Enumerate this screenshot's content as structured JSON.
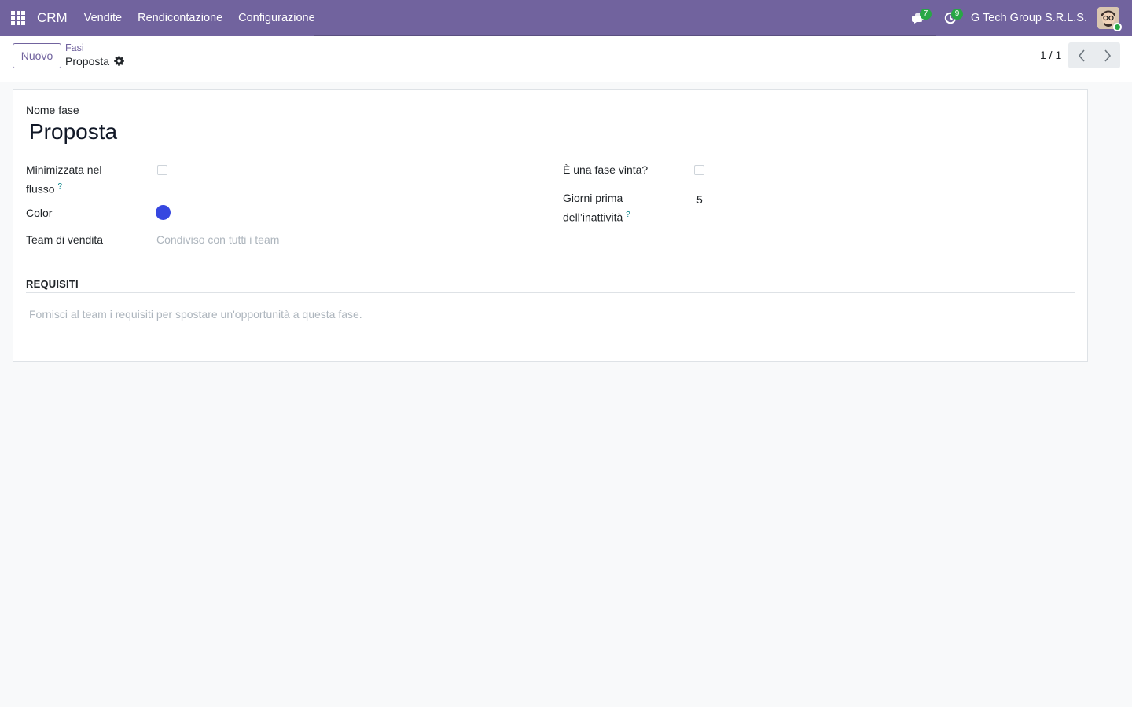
{
  "navbar": {
    "app_name": "CRM",
    "menu": [
      "Vendite",
      "Rendicontazione",
      "Configurazione"
    ],
    "messages_count": "7",
    "activities_count": "9",
    "company": "G Tech Group S.R.L.S.",
    "bg_color": "#71639e"
  },
  "control": {
    "new_label": "Nuovo",
    "breadcrumb_parent": "Fasi",
    "breadcrumb_current": "Proposta",
    "pager_value": "1 / 1"
  },
  "form": {
    "name_label": "Nome fase",
    "name_value": "Proposta",
    "folded_label": "Minimizzata nel flusso",
    "folded_label_line1": "Minimizzata nel",
    "folded_label_line2": "flusso",
    "folded_checked": false,
    "color_label": "Color",
    "color_value": "#3647e0",
    "team_label": "Team di vendita",
    "team_placeholder": "Condiviso con tutti i team",
    "won_label": "È una fase vinta?",
    "won_checked": false,
    "rotting_label_line1": "Giorni prima",
    "rotting_label_line2": "dell’inattività",
    "rotting_value": "5",
    "tooltip_mark": "?",
    "requirements_title": "REQUISITI",
    "requirements_placeholder": "Fornisci al team i requisiti per spostare un'opportunità a questa fase."
  }
}
